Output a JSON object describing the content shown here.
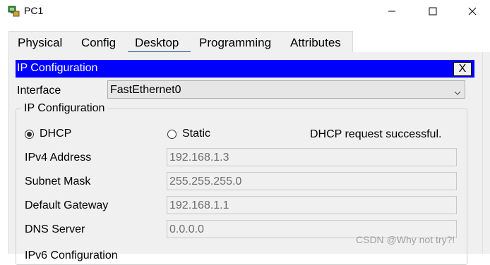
{
  "window": {
    "title": "PC1",
    "app_icon": "packet-tracer-pc-icon",
    "controls": [
      "minimize-icon",
      "maximize-icon",
      "close-icon"
    ]
  },
  "tabs": [
    {
      "label": "Physical"
    },
    {
      "label": "Config"
    },
    {
      "label": "Desktop",
      "selected": true
    },
    {
      "label": "Programming"
    },
    {
      "label": "Attributes"
    }
  ],
  "ip_config": {
    "header_title": "IP Configuration",
    "close_label": "X",
    "interface_label": "Interface",
    "interface_value": "FastEthernet0",
    "group_title": "IP Configuration",
    "dhcp_label": "DHCP",
    "static_label": "Static",
    "mode_selected": "DHCP",
    "status": "DHCP request successful.",
    "fields": [
      {
        "label": "IPv4 Address",
        "value": "192.168.1.3"
      },
      {
        "label": "Subnet Mask",
        "value": "255.255.255.0"
      },
      {
        "label": "Default Gateway",
        "value": "192.168.1.1"
      },
      {
        "label": "DNS Server",
        "value": "0.0.0.0"
      }
    ],
    "next_section_partial": "IPv6 Configuration"
  },
  "watermark": "CSDN @Why not try?!",
  "colors": {
    "header_bg": "#0000ff",
    "header_text": "#ffffff",
    "tab_underline": "#0f4c81",
    "panel_bg": "#f0f0f0"
  }
}
